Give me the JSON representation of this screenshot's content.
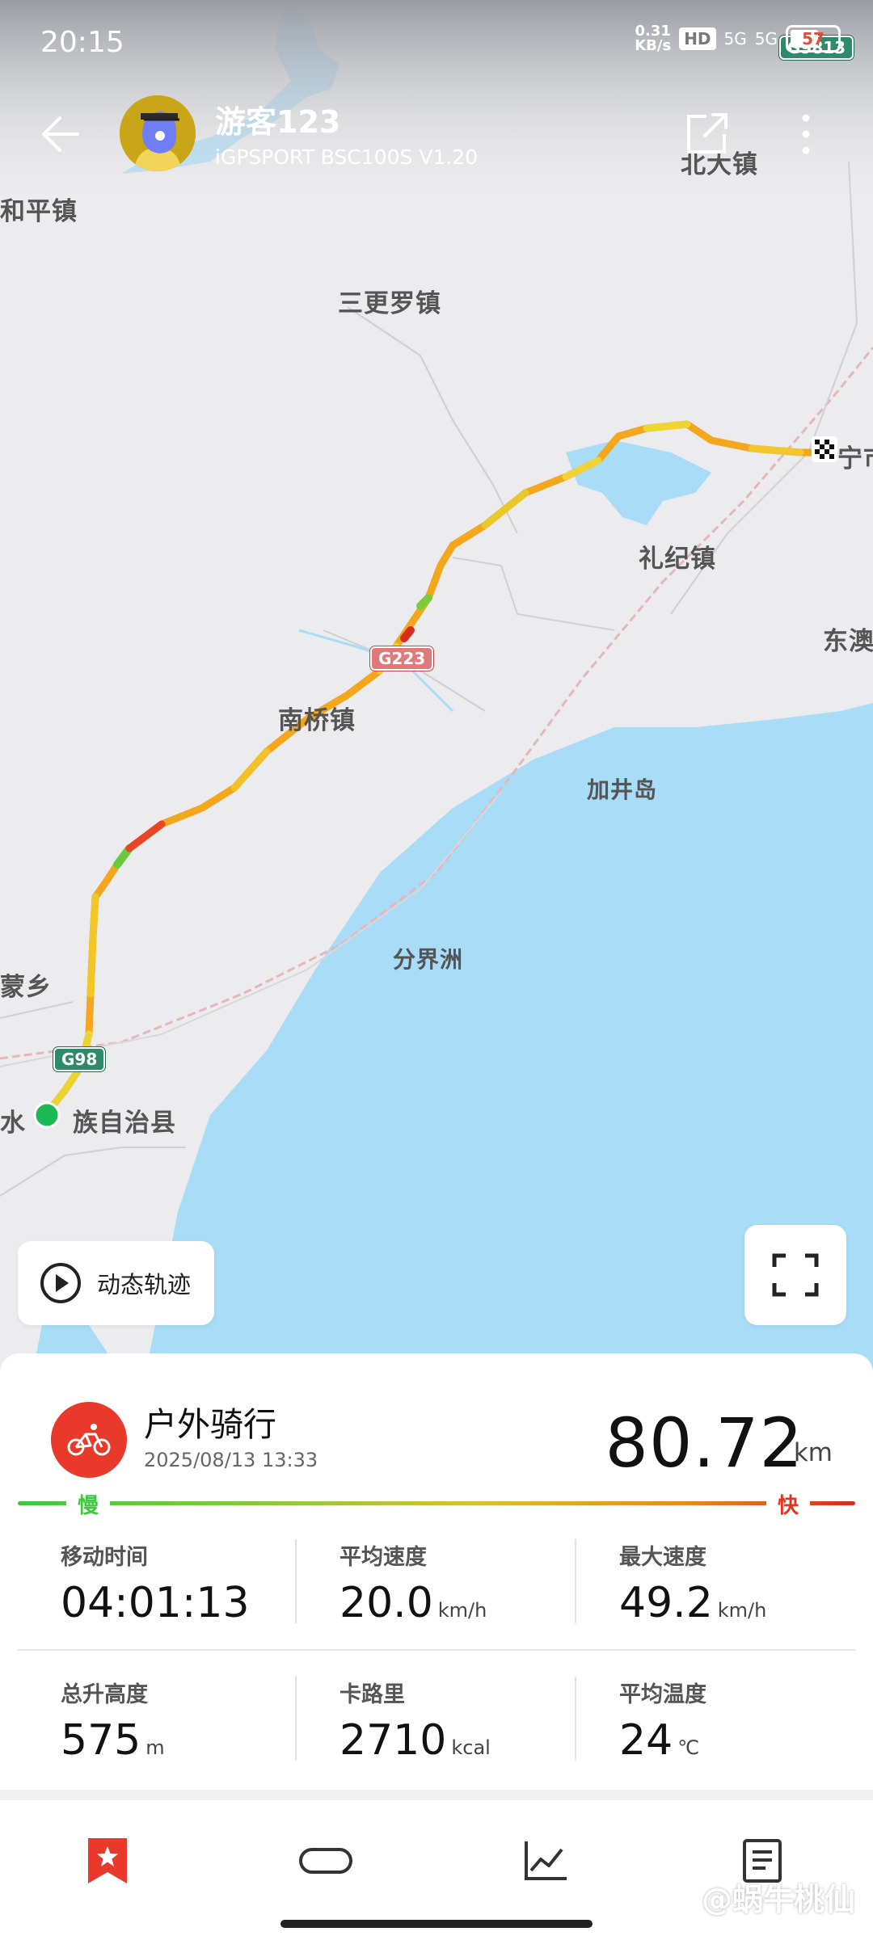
{
  "status_bar": {
    "time": "20:15",
    "net_speed": "0.31",
    "net_unit": "KB/s",
    "hd": "HD",
    "signal1": "5G",
    "signal2": "5G",
    "battery": "57"
  },
  "header": {
    "username": "游客123",
    "device": "iGPSPORT BSC100S  V1.20",
    "back_icon": "back-arrow-icon",
    "share_icon": "share-icon",
    "more_icon": "more-vertical-icon"
  },
  "map": {
    "places": {
      "p1": "和平镇",
      "p2": "北大镇",
      "p3": "三更罗镇",
      "p4": "宁市",
      "p5": "礼纪镇",
      "p6": "东澳",
      "p7": "南桥镇",
      "p8": "加井岛",
      "p9": "分界洲",
      "p10": "蒙乡",
      "p11": "水",
      "p12": "族自治县"
    },
    "shields": {
      "s1": "G9813",
      "s2": "G223",
      "s3": "G98"
    },
    "sea_color": "#a8dcf7",
    "land_color": "#ececee",
    "start_color": "#1db954"
  },
  "controls": {
    "dynamic_track": "动态轨迹"
  },
  "activity": {
    "type": "户外骑行",
    "datetime": "2025/08/13 13:33",
    "distance": "80.72",
    "distance_unit": "km",
    "slow_label": "慢",
    "fast_label": "快",
    "accent": "#e8392a"
  },
  "stats": {
    "moving_time": {
      "label": "移动时间",
      "value": "04:01:13",
      "unit": ""
    },
    "avg_speed": {
      "label": "平均速度",
      "value": "20.0",
      "unit": "km/h"
    },
    "max_speed": {
      "label": "最大速度",
      "value": "49.2",
      "unit": "km/h"
    },
    "elevation": {
      "label": "总升高度",
      "value": "575",
      "unit": "m"
    },
    "calories": {
      "label": "卡路里",
      "value": "2710",
      "unit": "kcal"
    },
    "avg_temp": {
      "label": "平均温度",
      "value": "24",
      "unit": "℃"
    }
  },
  "nav": {
    "items": [
      "bookmark-icon",
      "lap-icon",
      "chart-icon",
      "document-icon"
    ]
  },
  "watermark": "@蜗牛桃仙"
}
